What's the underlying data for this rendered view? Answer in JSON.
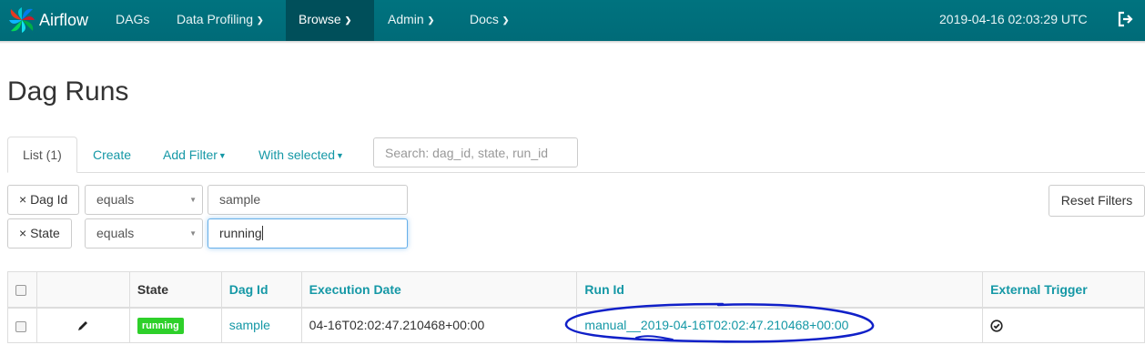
{
  "navbar": {
    "brand": "Airflow",
    "items": [
      {
        "label": "DAGs"
      },
      {
        "label": "Data Profiling"
      },
      {
        "label": "Browse"
      },
      {
        "label": "Admin"
      },
      {
        "label": "Docs"
      }
    ],
    "timestamp": "2019-04-16 02:03:29 UTC"
  },
  "page": {
    "title": "Dag Runs"
  },
  "tabs": {
    "list": "List (1)",
    "create": "Create",
    "add_filter": "Add Filter",
    "with_selected": "With selected"
  },
  "search": {
    "placeholder": "Search: dag_id, state, run_id"
  },
  "filters": [
    {
      "remove_label": "× Dag Id",
      "operator": "equals",
      "value": "sample"
    },
    {
      "remove_label": "× State",
      "operator": "equals",
      "value": "running"
    }
  ],
  "reset_label": "Reset Filters",
  "table": {
    "headers": [
      "State",
      "Dag Id",
      "Execution Date",
      "Run Id",
      "External Trigger"
    ],
    "rows": [
      {
        "state": "running",
        "dag_id": "sample",
        "execution_date": "04-16T02:02:47.210468+00:00",
        "run_id": "manual__2019-04-16T02:02:47.210468+00:00"
      }
    ]
  },
  "colors": {
    "navbar": "#00737f",
    "accent": "#1598a6",
    "running": "#2ed02a",
    "annotation": "#1020c8"
  }
}
